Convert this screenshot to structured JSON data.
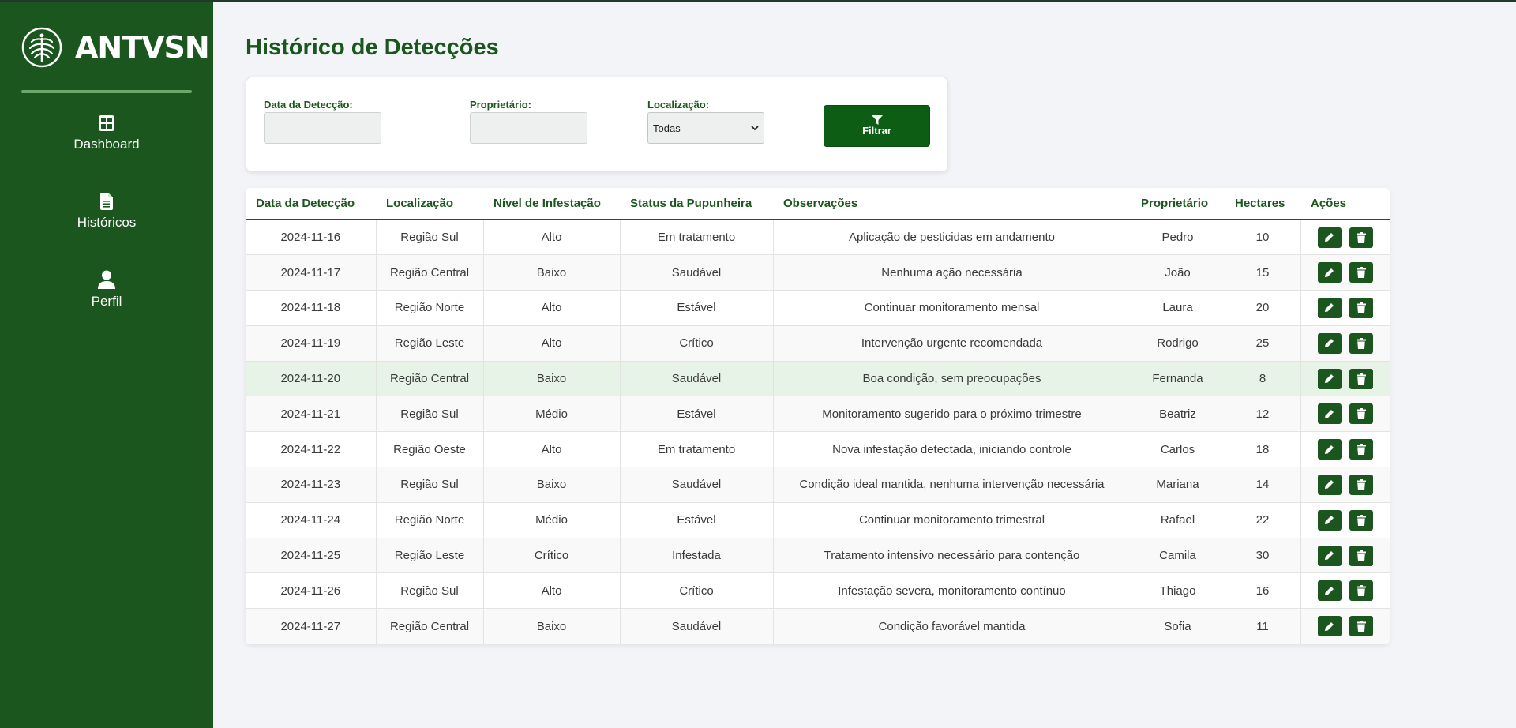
{
  "brand": {
    "name": "ANTVSN"
  },
  "nav": [
    {
      "label": "Dashboard",
      "icon": "grid-icon"
    },
    {
      "label": "Históricos",
      "icon": "document-icon"
    },
    {
      "label": "Perfil",
      "icon": "user-icon"
    }
  ],
  "page": {
    "title": "Histórico de Detecções"
  },
  "filters": {
    "date_label": "Data da Detecção:",
    "date_value": "",
    "owner_label": "Proprietário:",
    "owner_value": "",
    "location_label": "Localização:",
    "location_selected": "Todas",
    "button_label": "Filtrar"
  },
  "table": {
    "columns": [
      "Data da Detecção",
      "Localização",
      "Nível de Infestação",
      "Status da Pupunheira",
      "Observações",
      "Proprietário",
      "Hectares",
      "Ações"
    ],
    "rows": [
      [
        "2024-11-16",
        "Região Sul",
        "Alto",
        "Em tratamento",
        "Aplicação de pesticidas em andamento",
        "Pedro",
        "10"
      ],
      [
        "2024-11-17",
        "Região Central",
        "Baixo",
        "Saudável",
        "Nenhuma ação necessária",
        "João",
        "15"
      ],
      [
        "2024-11-18",
        "Região Norte",
        "Alto",
        "Estável",
        "Continuar monitoramento mensal",
        "Laura",
        "20"
      ],
      [
        "2024-11-19",
        "Região Leste",
        "Alto",
        "Crítico",
        "Intervenção urgente recomendada",
        "Rodrigo",
        "25"
      ],
      [
        "2024-11-20",
        "Região Central",
        "Baixo",
        "Saudável",
        "Boa condição, sem preocupações",
        "Fernanda",
        "8"
      ],
      [
        "2024-11-21",
        "Região Sul",
        "Médio",
        "Estável",
        "Monitoramento sugerido para o próximo trimestre",
        "Beatriz",
        "12"
      ],
      [
        "2024-11-22",
        "Região Oeste",
        "Alto",
        "Em tratamento",
        "Nova infestação detectada, iniciando controle",
        "Carlos",
        "18"
      ],
      [
        "2024-11-23",
        "Região Sul",
        "Baixo",
        "Saudável",
        "Condição ideal mantida, nenhuma intervenção necessária",
        "Mariana",
        "14"
      ],
      [
        "2024-11-24",
        "Região Norte",
        "Médio",
        "Estável",
        "Continuar monitoramento trimestral",
        "Rafael",
        "22"
      ],
      [
        "2024-11-25",
        "Região Leste",
        "Crítico",
        "Infestada",
        "Tratamento intensivo necessário para contenção",
        "Camila",
        "30"
      ],
      [
        "2024-11-26",
        "Região Sul",
        "Alto",
        "Crítico",
        "Infestação severa, monitoramento contínuo",
        "Thiago",
        "16"
      ],
      [
        "2024-11-27",
        "Região Central",
        "Baixo",
        "Saudável",
        "Condição favorável mantida",
        "Sofia",
        "11"
      ]
    ],
    "highlighted_row": 4,
    "row_actions": [
      "edit-icon",
      "trash-icon"
    ]
  },
  "colors": {
    "sidebar": "#1a561d",
    "accent": "#1a561d",
    "button": "#0d5e14",
    "highlight_row": "#e7f3e7",
    "background": "#f3f4f8"
  }
}
